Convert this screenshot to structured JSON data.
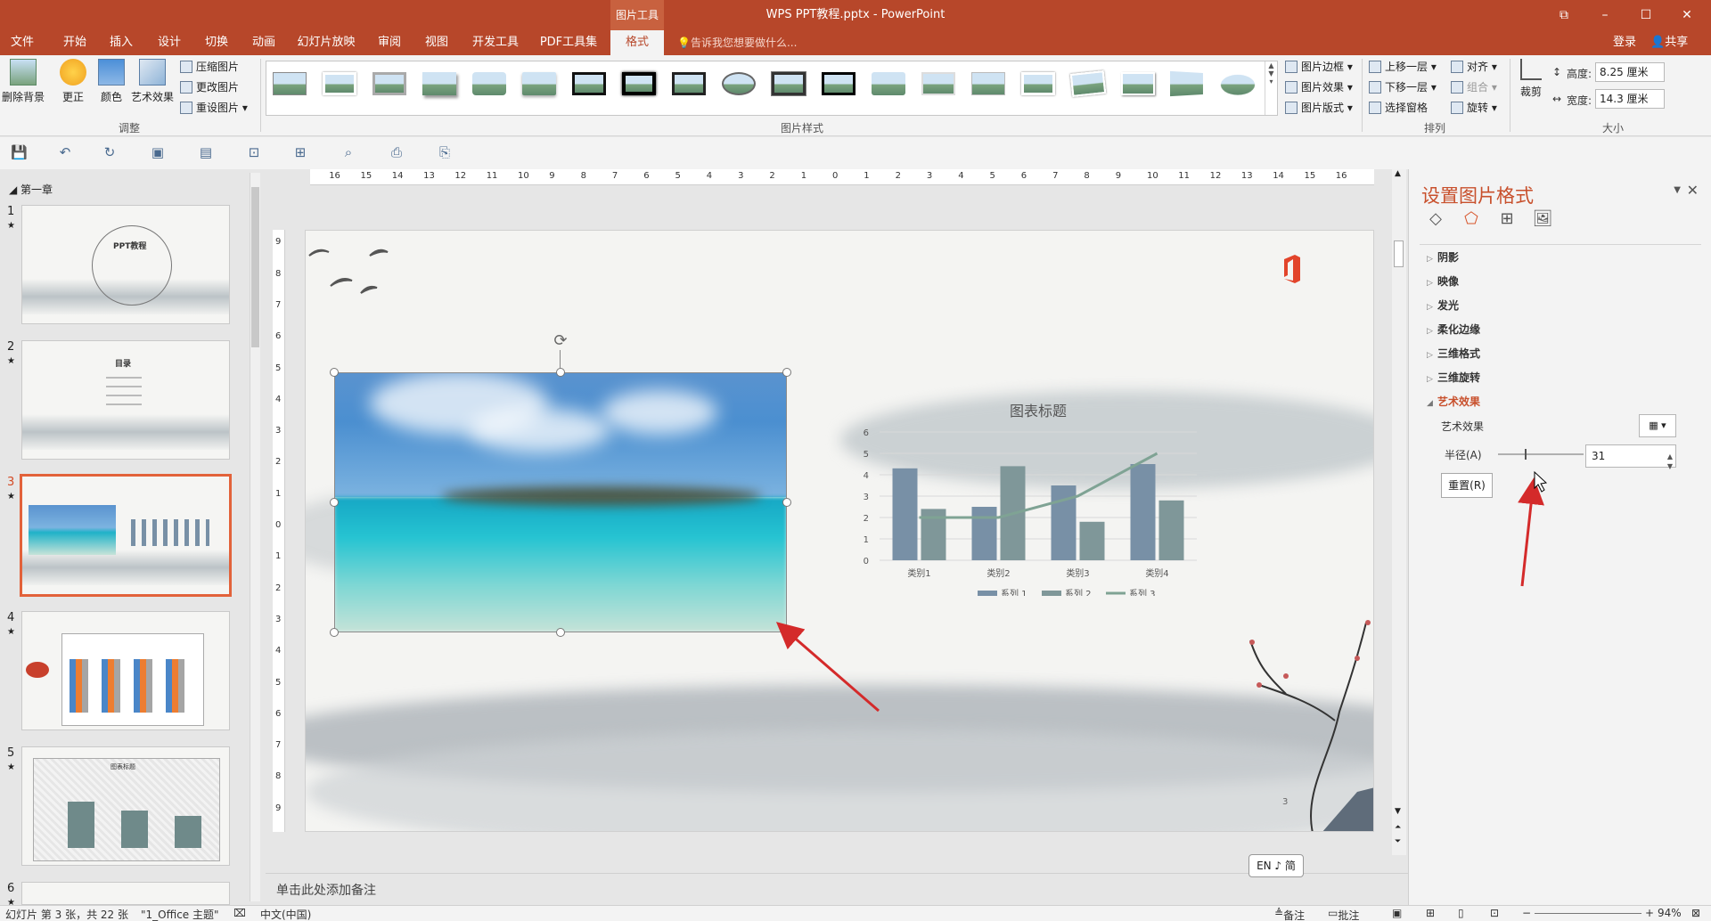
{
  "titlebar": {
    "context_tab": "图片工具",
    "title": "WPS PPT教程.pptx - PowerPoint",
    "restore_icon": "ribbon-display-icon",
    "minimize": "–",
    "maximize": "☐",
    "close": "✕"
  },
  "tabs": {
    "items": [
      "文件",
      "开始",
      "插入",
      "设计",
      "切换",
      "动画",
      "幻灯片放映",
      "审阅",
      "视图",
      "开发工具",
      "PDF工具集",
      "格式"
    ],
    "active": "格式",
    "tell_me": "告诉我您想要做什么...",
    "login": "登录",
    "share": "共享"
  },
  "ribbon": {
    "adjust": {
      "remove_bg": "删除背景",
      "corrections": "更正",
      "color": "颜色",
      "artistic": "艺术效果",
      "compress": "压缩图片",
      "change": "更改图片",
      "reset": "重设图片",
      "label": "调整"
    },
    "styles": {
      "label": "图片样式"
    },
    "style_menu": {
      "border": "图片边框",
      "effects": "图片效果",
      "layout": "图片版式"
    },
    "arrange": {
      "forward": "上移一层",
      "backward": "下移一层",
      "selection": "选择窗格",
      "align": "对齐",
      "group": "组合",
      "rotate": "旋转",
      "label": "排列"
    },
    "size": {
      "crop": "裁剪",
      "height_label": "高度:",
      "height_value": "8.25 厘米",
      "width_label": "宽度:",
      "width_value": "14.3 厘米",
      "label": "大小"
    }
  },
  "left_pane": {
    "section": "第一章",
    "slides": [
      {
        "num": "1",
        "text": "PPT教程"
      },
      {
        "num": "2",
        "text": "目录"
      },
      {
        "num": "3",
        "text": ""
      },
      {
        "num": "4",
        "text": ""
      },
      {
        "num": "5",
        "text": "图表标题"
      },
      {
        "num": "6",
        "text": ""
      }
    ]
  },
  "slide": {
    "page_number": "3"
  },
  "chart_data": {
    "type": "bar",
    "title": "图表标题",
    "categories": [
      "类别1",
      "类别2",
      "类别3",
      "类别4"
    ],
    "series": [
      {
        "name": "系列 1",
        "type": "bar",
        "values": [
          4.3,
          2.5,
          3.5,
          4.5
        ],
        "color": "#7890a6"
      },
      {
        "name": "系列 2",
        "type": "bar",
        "values": [
          2.4,
          4.4,
          1.8,
          2.8
        ],
        "color": "#7f9799"
      },
      {
        "name": "系列 3",
        "type": "line",
        "values": [
          2,
          2,
          3,
          5
        ],
        "color": "#7fa394"
      }
    ],
    "ylim": [
      0,
      6
    ],
    "yticks": [
      "0",
      "1",
      "2",
      "3",
      "4",
      "5",
      "6"
    ],
    "grid": true,
    "legend": "bottom"
  },
  "notes": {
    "placeholder": "单击此处添加备注"
  },
  "ime": {
    "label": "EN ♪ 简"
  },
  "format_pane": {
    "title": "设置图片格式",
    "sections": [
      "阴影",
      "映像",
      "发光",
      "柔化边缘",
      "三维格式",
      "三维旋转",
      "艺术效果"
    ],
    "open_section": "艺术效果",
    "artistic_label": "艺术效果",
    "radius_label": "半径(A)",
    "radius_value": "31",
    "radius_fraction": 0.31,
    "reset": "重置(R)"
  },
  "status": {
    "slide_info": "幻灯片 第 3 张，共 22 张",
    "theme": "\"1_Office 主题\"",
    "language": "中文(中国)",
    "notes": "备注",
    "comments": "批注",
    "zoom": "94%"
  },
  "colors": {
    "accent": "#b7472a",
    "pane_title": "#c8502c",
    "arrow": "#d42a2a"
  }
}
